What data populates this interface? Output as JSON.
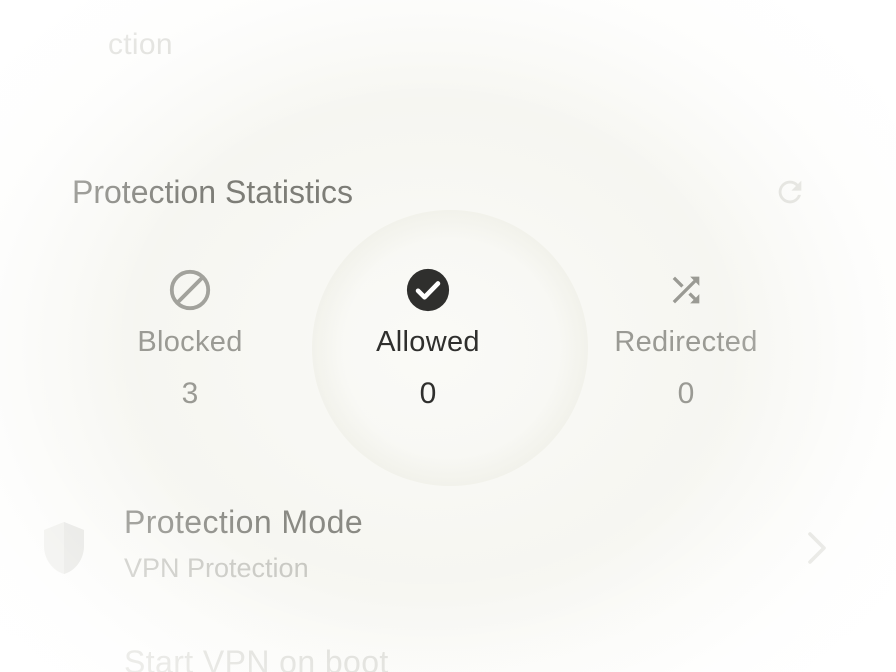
{
  "header": {
    "title_fragment": "ction"
  },
  "statistics": {
    "title": "Protection Statistics",
    "refresh_icon": "refresh-icon",
    "items": [
      {
        "id": "blocked",
        "icon": "block-icon",
        "label": "Blocked",
        "value": "3"
      },
      {
        "id": "allowed",
        "icon": "check-circle-icon",
        "label": "Allowed",
        "value": "0"
      },
      {
        "id": "redirected",
        "icon": "shuffle-icon",
        "label": "Redirected",
        "value": "0"
      }
    ]
  },
  "protection_mode": {
    "icon": "shield-icon",
    "title": "Protection Mode",
    "subtitle": "VPN Protection",
    "chevron_icon": "chevron-right-icon"
  },
  "start_on_boot": {
    "label": "Start VPN on boot"
  },
  "colors": {
    "primary_text": "#2f2f2d",
    "muted_text": "#9a9a94",
    "faint_text": "#c4c4be",
    "background": "#f6f6f1"
  }
}
